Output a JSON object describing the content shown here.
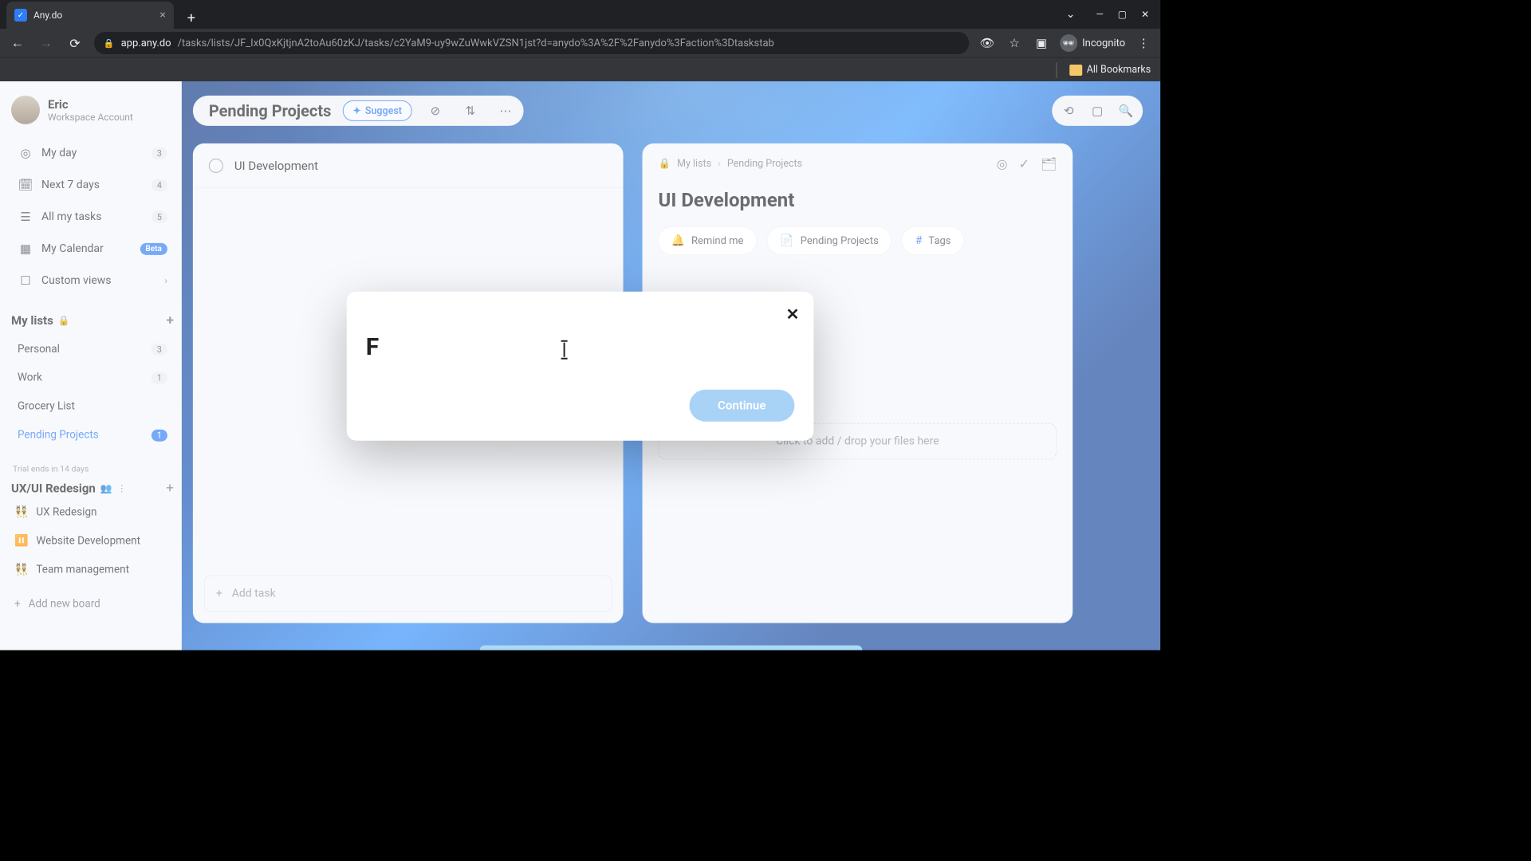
{
  "browser": {
    "tab_title": "Any.do",
    "url_host": "app.any.do",
    "url_path": "/tasks/lists/JF_Ix0QxKjtjnA2toAu60zKJ/tasks/c2YaM9-uy9wZuWwkVZSN1jst?d=anydo%3A%2F%2Fanydo%3Faction%3Dtaskstab",
    "incognito_label": "Incognito",
    "bookmarks_label": "All Bookmarks"
  },
  "profile": {
    "name": "Eric",
    "subtitle": "Workspace Account"
  },
  "nav": [
    {
      "icon": "target-icon",
      "label": "My day",
      "count": "3"
    },
    {
      "icon": "calendar7-icon",
      "label": "Next 7 days",
      "count": "4"
    },
    {
      "icon": "list-icon",
      "label": "All my tasks",
      "count": "5"
    },
    {
      "icon": "calendar-icon",
      "label": "My Calendar",
      "badge": "Beta"
    },
    {
      "icon": "bookmark-icon",
      "label": "Custom views",
      "chevron": true
    }
  ],
  "mylists": {
    "title": "My lists",
    "items": [
      {
        "label": "Personal",
        "count": "3"
      },
      {
        "label": "Work",
        "count": "1"
      },
      {
        "label": "Grocery List"
      },
      {
        "label": "Pending Projects",
        "count": "1",
        "active": true
      }
    ]
  },
  "trial_note": "Trial ends in 14 days",
  "workspace": {
    "title": "UX/UI Redesign",
    "boards": [
      {
        "icon": "👯",
        "label": "UX Redesign"
      },
      {
        "icon": "⏸️",
        "label": "Website Development"
      },
      {
        "icon": "👯",
        "label": "Team management"
      }
    ],
    "add_board": "Add new board"
  },
  "header": {
    "title": "Pending Projects",
    "suggest": "Suggest"
  },
  "left_panel": {
    "task": "UI Development",
    "add_task": "Add task"
  },
  "right_panel": {
    "crumb1": "My lists",
    "crumb2": "Pending Projects",
    "title": "UI Development",
    "chip_remind": "Remind me",
    "chip_project": "Pending Projects",
    "chip_tags": "Tags",
    "attach": "Click to add / drop your files here"
  },
  "modal": {
    "input_value": "F",
    "continue": "Continue"
  }
}
